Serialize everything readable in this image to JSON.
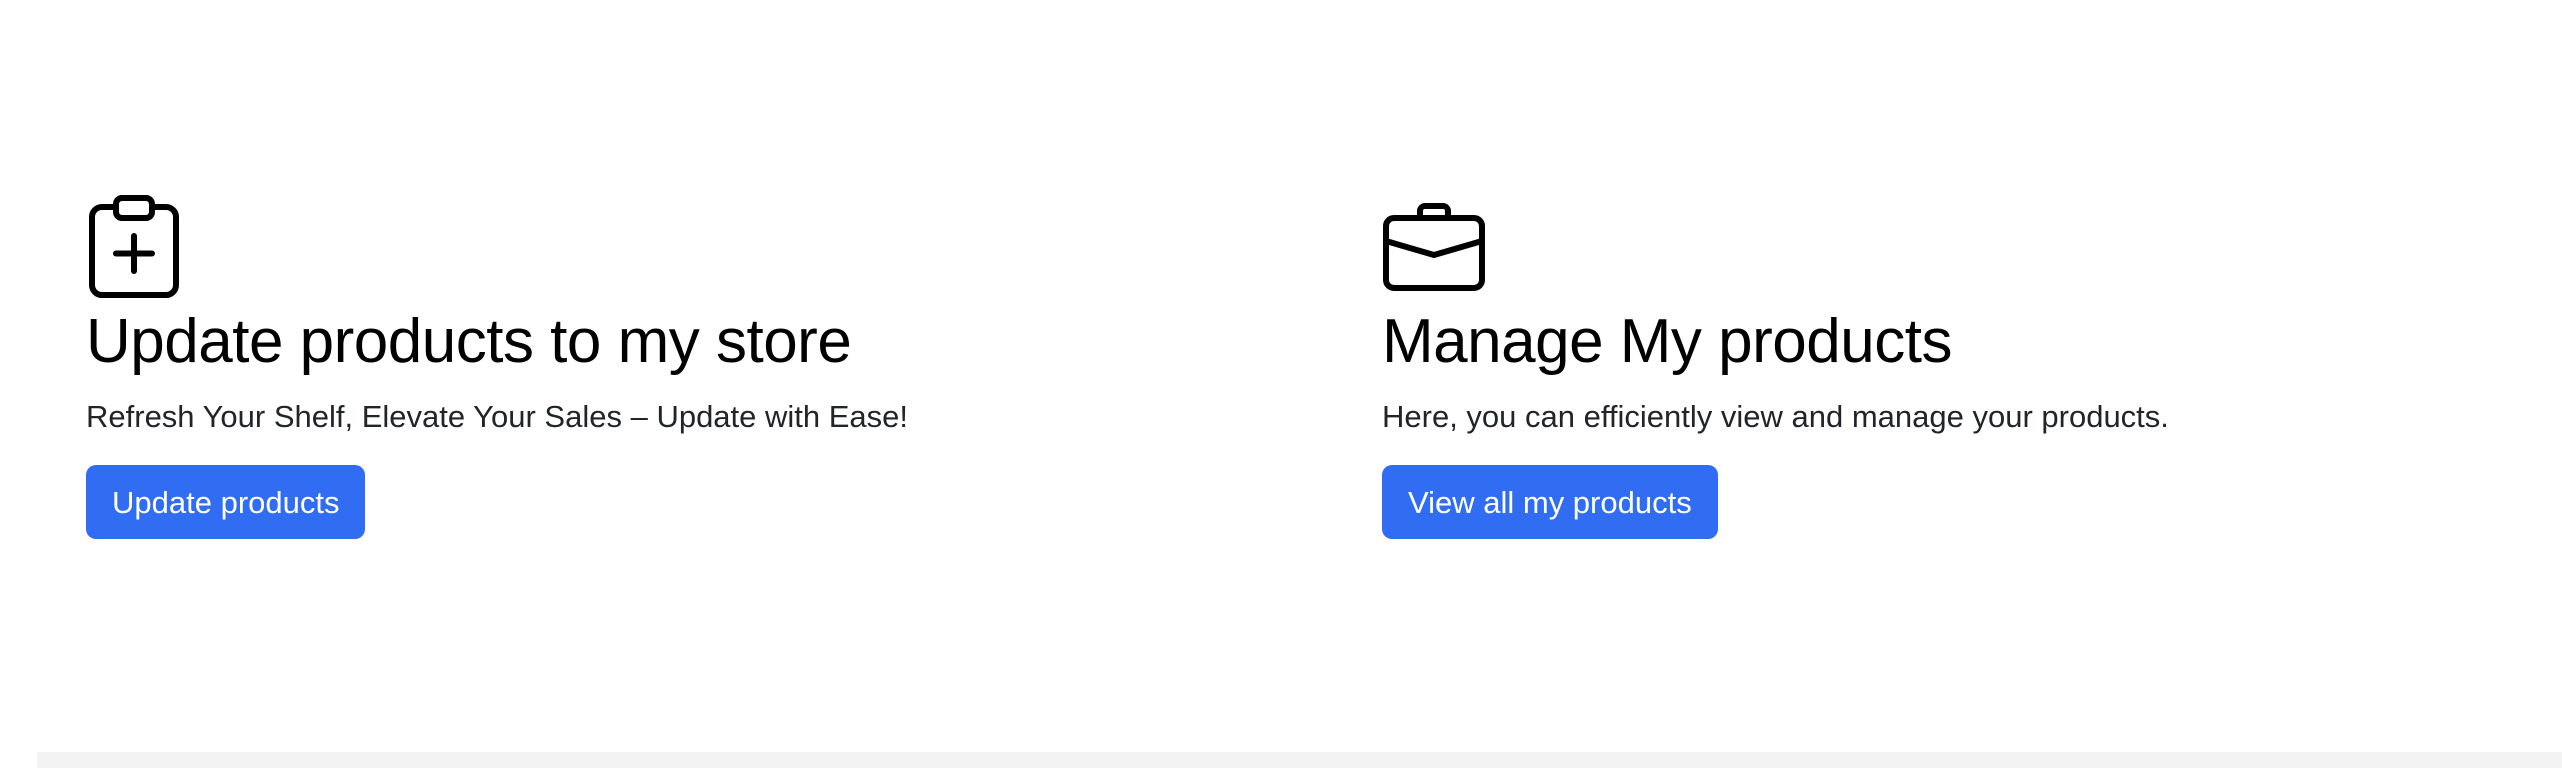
{
  "cards": {
    "update": {
      "icon": "clipboard-plus-icon",
      "title": "Update products to my store",
      "description": "Refresh Your Shelf, Elevate Your Sales – Update with Ease!",
      "button_label": "Update products"
    },
    "manage": {
      "icon": "briefcase-icon",
      "title": "Manage My products",
      "description": "Here, you can efficiently view and manage your products.",
      "button_label": "View all my products"
    }
  },
  "colors": {
    "button_background": "#316df2",
    "button_text": "#ffffff",
    "footer_band": "#f3f3f3"
  }
}
